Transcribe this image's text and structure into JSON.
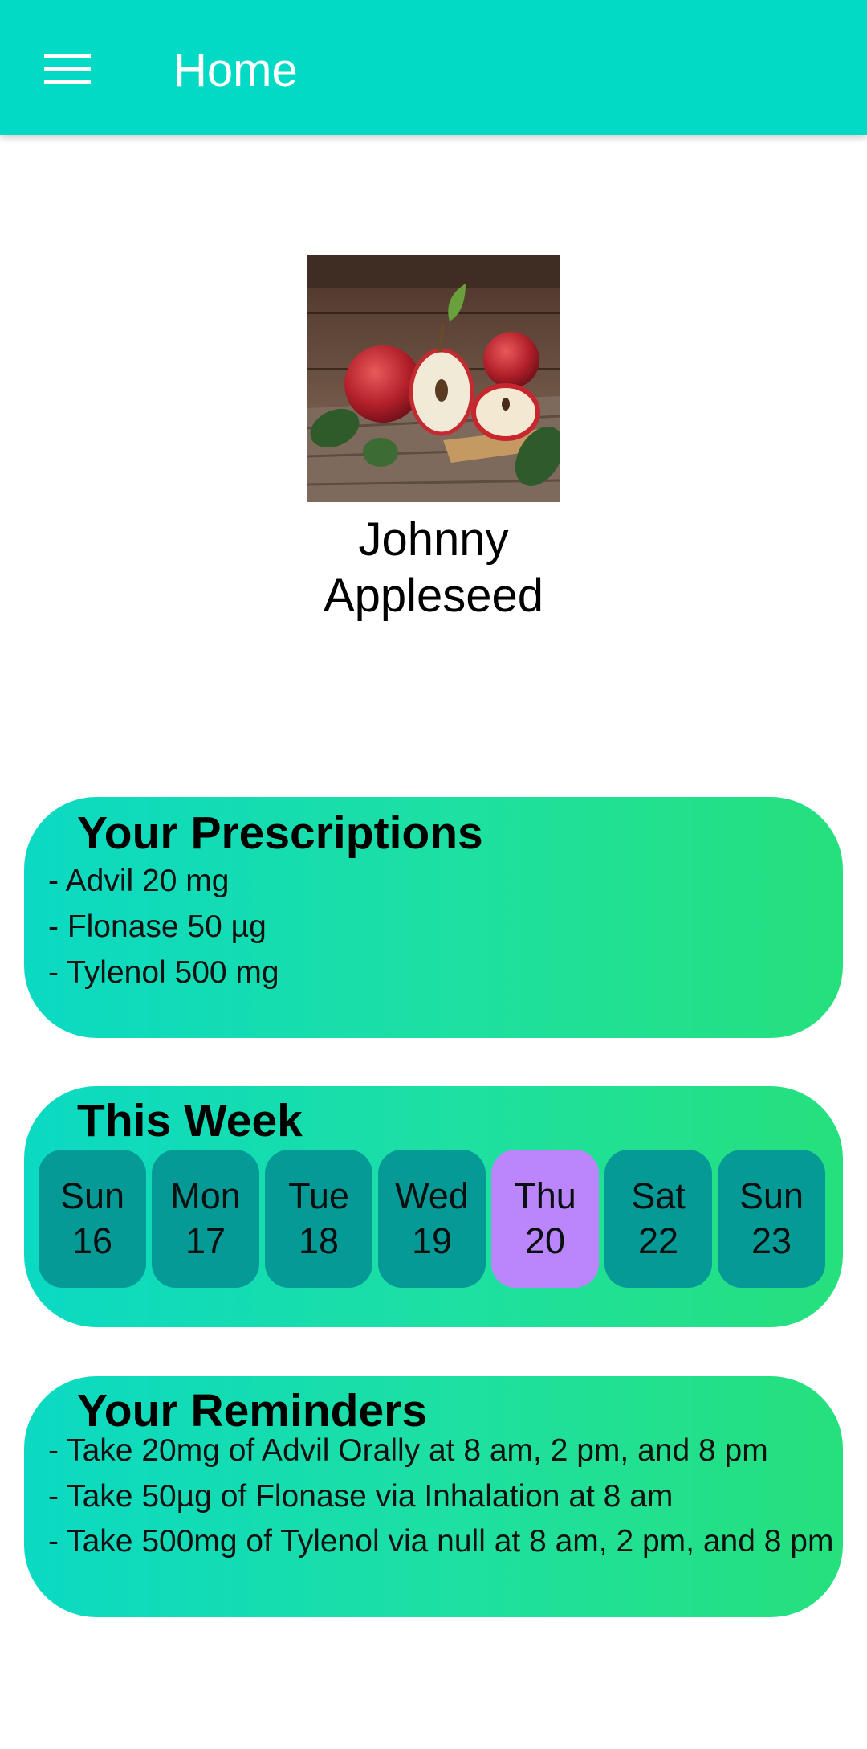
{
  "app_bar": {
    "title": "Home",
    "menu_icon": "hamburger-menu-icon",
    "color": "#03dac6"
  },
  "profile": {
    "name": "Johnny Appleseed",
    "avatar": "apples-photo"
  },
  "prescriptions": {
    "title": "Your Prescriptions",
    "items": [
      "- Advil 20 mg",
      "- Flonase 50 µg",
      "- Tylenol 500 mg"
    ]
  },
  "week": {
    "title": "This Week",
    "selected_color": "#bb86fc",
    "day_color": "#069a97",
    "days": [
      {
        "name": "Sun",
        "date": "16"
      },
      {
        "name": "Mon",
        "date": "17"
      },
      {
        "name": "Tue",
        "date": "18"
      },
      {
        "name": "Wed",
        "date": "19"
      },
      {
        "name": "Thu",
        "date": "20",
        "selected": true
      },
      {
        "name": "Sat",
        "date": "22"
      },
      {
        "name": "Sun",
        "date": "23"
      }
    ]
  },
  "reminders": {
    "title": "Your Reminders",
    "items": [
      "- Take 20mg of Advil Orally at 8 am, 2 pm, and 8 pm",
      "- Take 50µg of Flonase via Inhalation at 8 am",
      "- Take 500mg of Tylenol via null at 8 am, 2 pm, and 8 pm"
    ]
  }
}
